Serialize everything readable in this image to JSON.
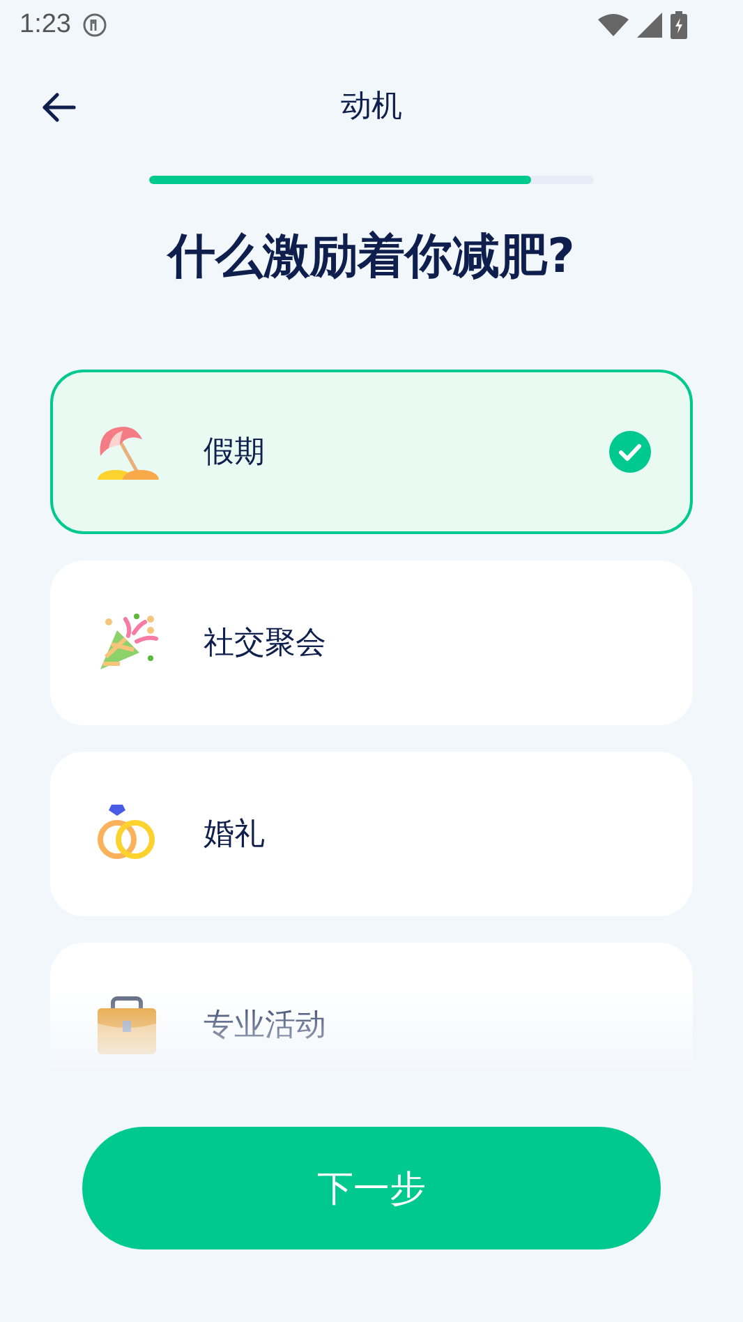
{
  "status_bar": {
    "time": "1:23"
  },
  "header": {
    "title": "动机"
  },
  "progress": {
    "level": 0.86
  },
  "question": "什么激励着你减肥?",
  "options": [
    {
      "label": "假期",
      "kind": "beach",
      "selected": true
    },
    {
      "label": "社交聚会",
      "kind": "party",
      "selected": false
    },
    {
      "label": "婚礼",
      "kind": "rings",
      "selected": false
    },
    {
      "label": "专业活动",
      "kind": "briefcase",
      "selected": false
    }
  ],
  "next_button": "下一步"
}
